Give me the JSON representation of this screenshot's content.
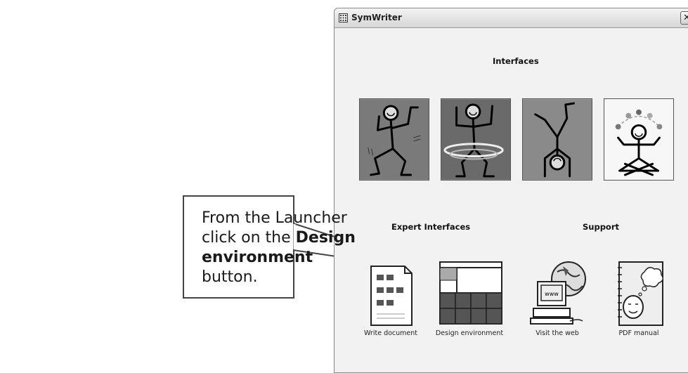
{
  "window": {
    "title": "SymWriter",
    "close_glyph": "✕"
  },
  "sections": {
    "interfaces": "Interfaces",
    "expert": "Expert Interfaces",
    "support": "Support"
  },
  "interface_tiles": [
    {
      "icon": "dancing-figure-icon"
    },
    {
      "icon": "hula-hoop-figure-icon"
    },
    {
      "icon": "handstand-figure-icon"
    },
    {
      "icon": "juggling-figure-icon"
    }
  ],
  "buttons": [
    {
      "label": "Write document",
      "icon": "document-icon"
    },
    {
      "label": "Design environment",
      "icon": "grid-layout-icon"
    },
    {
      "label": "Visit the web",
      "icon": "globe-computer-icon"
    },
    {
      "label": "PDF manual",
      "icon": "manual-icon"
    }
  ],
  "callout": {
    "line1": "From the Launcher",
    "line2_prefix": "click on the ",
    "line2_bold": "Design",
    "line3_bold": "environment",
    "line3_suffix": " button."
  },
  "colors": {
    "tile_dark": "#6e6e6e",
    "tile_mid": "#8c8c8c",
    "border": "#444444"
  }
}
